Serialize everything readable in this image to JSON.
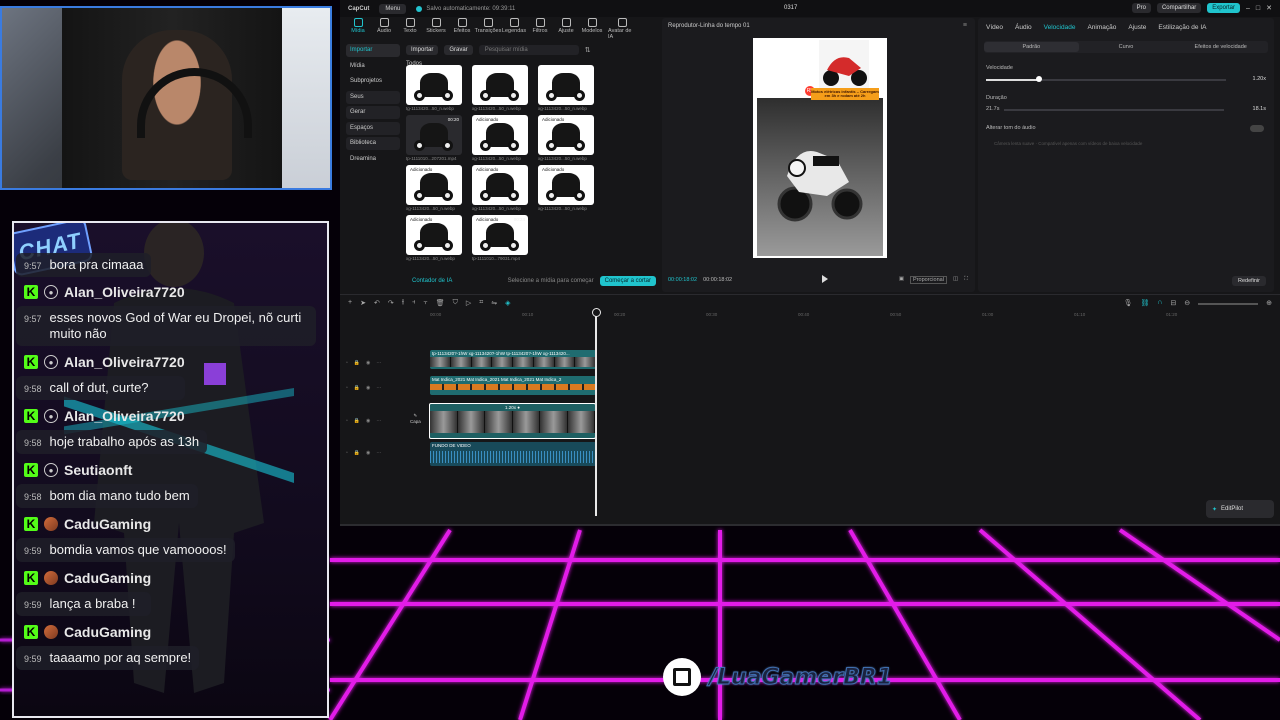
{
  "chat": {
    "badge": "CHAT",
    "messages": [
      {
        "user": "",
        "time": "9:57",
        "text": "bora pra cimaaa",
        "icon": "user-icon"
      },
      {
        "user": "Alan_Oliveira7720",
        "time": "9:57",
        "text": "esses novos God of War eu Dropei, nõ curti muito não",
        "icon": "user-icon"
      },
      {
        "user": "Alan_Oliveira7720",
        "time": "9:58",
        "text": "call of dut, curte?",
        "icon": "user-icon"
      },
      {
        "user": "Alan_Oliveira7720",
        "time": "9:58",
        "text": "hoje trabalho após as 13h",
        "icon": "user-icon"
      },
      {
        "user": "Seutiaonft",
        "time": "9:58",
        "text": "bom dia mano tudo bem",
        "icon": "user-icon"
      },
      {
        "user": "CaduGaming",
        "time": "9:59",
        "text": "bomdia vamos que vamoooos!",
        "icon": "avatar-icon"
      },
      {
        "user": "CaduGaming",
        "time": "9:59",
        "text": "lança a braba !",
        "icon": "avatar-icon"
      },
      {
        "user": "CaduGaming",
        "time": "9:59",
        "text": "taaaamo por aq sempre!",
        "icon": "avatar-icon"
      }
    ]
  },
  "capcut": {
    "logo": "CapCut",
    "menu": "Menu",
    "autosave": "Salvo automaticamente: 09:39:11",
    "title": "0317",
    "pro": "Pro",
    "share": "Compartilhar",
    "export": "Exportar",
    "tools": [
      "Mídia",
      "Áudio",
      "Texto",
      "Stickers",
      "Efeitos",
      "Transições",
      "Legendas",
      "Filtros",
      "Ajuste",
      "Modelos",
      "Avatar de IA"
    ],
    "nav": [
      "Importar",
      "Mídia",
      "Subprojetos",
      "Seus",
      "Gerar",
      "Espaços",
      "Biblioteca",
      "Dreamina"
    ],
    "media": {
      "import": "Importar",
      "record": "Gravar",
      "search_placeholder": "Pesquisar mídia",
      "section": "Todos",
      "items": [
        {
          "label": "tg-1113420...50_n.webp",
          "tag": "",
          "dur": ""
        },
        {
          "label": "xg-1113420...50_n.webp",
          "tag": "",
          "dur": ""
        },
        {
          "label": "xg-1113420...50_n.webp",
          "tag": "",
          "dur": ""
        },
        {
          "label": "tp-1111010...207201.mp4",
          "tag": "",
          "dur": "00:20"
        },
        {
          "label": "xg-1113420...50_n.webp",
          "tag": "Adicionado",
          "dur": ""
        },
        {
          "label": "xg-1113420...50_n.webp",
          "tag": "Adicionado",
          "dur": ""
        },
        {
          "label": "xg-1113420...50_n.webp",
          "tag": "Adicionado",
          "dur": ""
        },
        {
          "label": "xg-1113420...50_n.webp",
          "tag": "Adicionado",
          "dur": ""
        },
        {
          "label": "xg-1113420...50_n.webp",
          "tag": "Adicionado",
          "dur": ""
        },
        {
          "label": "xg-1113420...50_n.webp",
          "tag": "Adicionado",
          "dur": ""
        },
        {
          "label": "tp-1111010...79031.mp4",
          "tag": "Adicionado",
          "dur": "00:24"
        }
      ],
      "footer_left": "Contador de IA",
      "footer_hint": "Selecione a mídia para começar",
      "footer_btn": "Começar a cortar"
    },
    "player": {
      "title": "Reprodutor-Linha do tempo 01",
      "time": "00:00:18:02",
      "duration": "00:00:18:02",
      "ratio": "Proporcional",
      "banner": "Motos elétricas infantis – Carregam em 3h e rodam até 2h",
      "badge": "R$"
    },
    "inspector": {
      "tabs": [
        "Vídeo",
        "Áudio",
        "Velocidade",
        "Animação",
        "Ajuste",
        "Estilização de IA"
      ],
      "active_tab": "Velocidade",
      "modes": [
        "Padrão",
        "Curvo",
        "Efeitos de velocidade"
      ],
      "speed_label": "Velocidade",
      "speed_value": "1.20x",
      "speed_fraction": 0.22,
      "duration_label": "Duração",
      "duration_from": "21.7s",
      "duration_to": "18.1s",
      "pitch_label": "Alterar tom do áudio",
      "hint": "Câmera lenta suave · Compatível apenas com vídeos de baixa velocidade",
      "reset": "Redefinir"
    },
    "timeline": {
      "ruler": [
        "00:00",
        "00:10",
        "00:20",
        "00:30",
        "00:40",
        "00:50",
        "01:00",
        "01:10",
        "01:20"
      ],
      "clip1": "tp-1113420?-1hW  xg-1113420?-1hW  tp-1113420?-1hW  xg-1113420...",
      "clip2": "Mat Indica_2021  Mat Indica_2021  Mat Indica_2021  Mat Indica_2",
      "clip3": "1.20x ●",
      "clip4": "FUNDO DE VIDEO",
      "cover": "Capa",
      "editpilot": "EditPilot"
    }
  },
  "brand": {
    "handle": "/LuaGamerBR1"
  }
}
